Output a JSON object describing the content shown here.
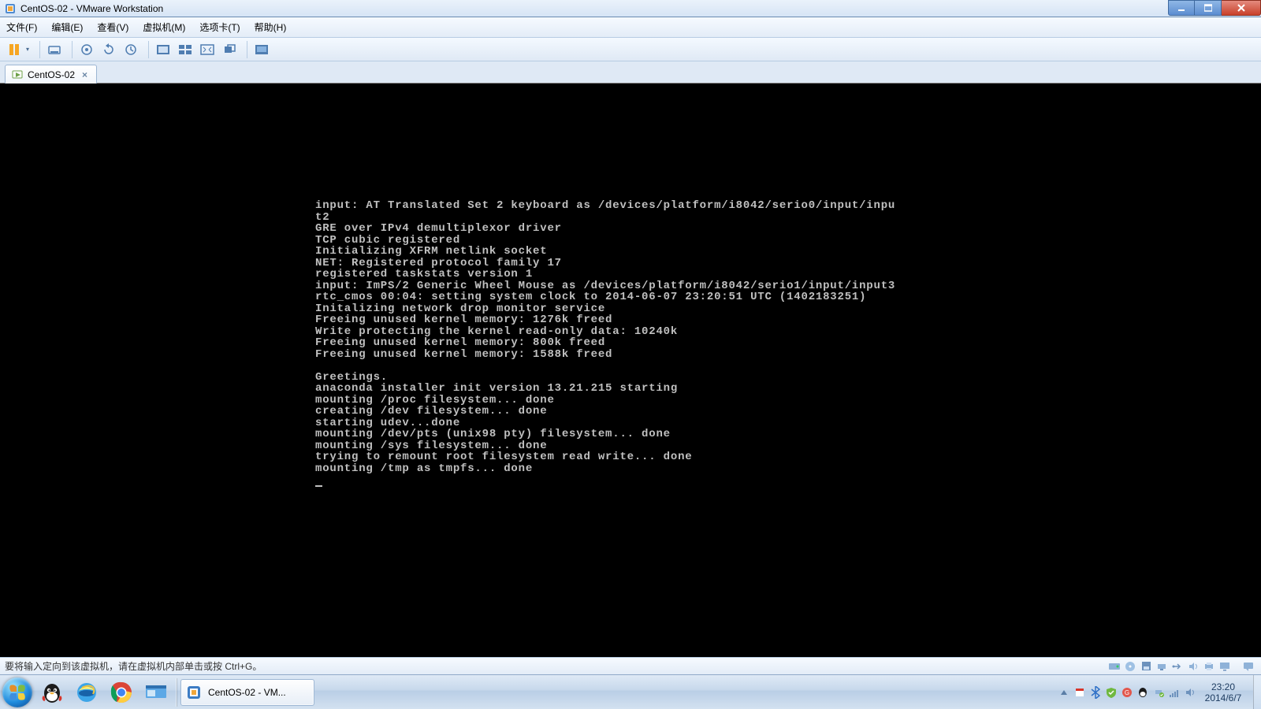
{
  "window": {
    "title": "CentOS-02 - VMware Workstation"
  },
  "menus": {
    "file": "文件(F)",
    "edit": "编辑(E)",
    "view": "查看(V)",
    "vm": "虚拟机(M)",
    "tabs": "选项卡(T)",
    "help": "帮助(H)"
  },
  "tab": {
    "label": "CentOS-02"
  },
  "console_lines": [
    "input: AT Translated Set 2 keyboard as /devices/platform/i8042/serio0/input/inpu",
    "t2",
    "GRE over IPv4 demultiplexor driver",
    "TCP cubic registered",
    "Initializing XFRM netlink socket",
    "NET: Registered protocol family 17",
    "registered taskstats version 1",
    "input: ImPS/2 Generic Wheel Mouse as /devices/platform/i8042/serio1/input/input3",
    "rtc_cmos 00:04: setting system clock to 2014-06-07 23:20:51 UTC (1402183251)",
    "Initalizing network drop monitor service",
    "Freeing unused kernel memory: 1276k freed",
    "Write protecting the kernel read-only data: 10240k",
    "Freeing unused kernel memory: 800k freed",
    "Freeing unused kernel memory: 1588k freed",
    "",
    "Greetings.",
    "anaconda installer init version 13.21.215 starting",
    "mounting /proc filesystem... done",
    "creating /dev filesystem... done",
    "starting udev...done",
    "mounting /dev/pts (unix98 pty) filesystem... done",
    "mounting /sys filesystem... done",
    "trying to remount root filesystem read write... done",
    "mounting /tmp as tmpfs... done"
  ],
  "vm_status": {
    "hint": "要将输入定向到该虚拟机，请在虚拟机内部单击或按 Ctrl+G。"
  },
  "taskbar": {
    "running_label": "CentOS-02 - VM..."
  },
  "clock": {
    "time": "23:20",
    "date": "2014/6/7"
  }
}
